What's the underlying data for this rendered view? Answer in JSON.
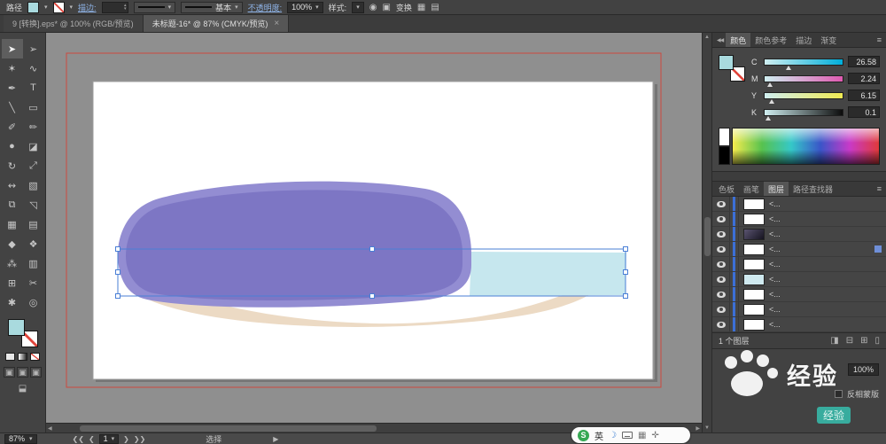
{
  "icons": {
    "caret": "▾",
    "spin_up": "▴",
    "spin_down": "▾",
    "scroll_up": "▲",
    "scroll_down": "▼",
    "scroll_left": "◀",
    "scroll_right": "▶"
  },
  "control_bar": {
    "selection_type": "路径",
    "fill_color": "#a9dade",
    "stroke_label": "描边:",
    "brush_value": "基本",
    "opacity_label": "不透明度:",
    "opacity_value": "100%",
    "style_label": "样式:",
    "recolor_icon": "◉",
    "doc_icon": "▣",
    "transform_label": "变换",
    "align_icon_1": "▦",
    "align_icon_2": "▤"
  },
  "tabs": [
    {
      "label": "9 [转换].eps* @ 100% (RGB/预览)"
    },
    {
      "label": "未标题-16* @ 87% (CMYK/预览)",
      "close": "×"
    }
  ],
  "toolbar": {
    "fill_color": "#a9dade",
    "tools": [
      {
        "name": "selection-tool",
        "glyph": "➤"
      },
      {
        "name": "direct-selection-tool",
        "glyph": "➢"
      },
      {
        "name": "magic-wand-tool",
        "glyph": "✶"
      },
      {
        "name": "lasso-tool",
        "glyph": "∿"
      },
      {
        "name": "pen-tool",
        "glyph": "✒"
      },
      {
        "name": "type-tool",
        "glyph": "T"
      },
      {
        "name": "line-segment-tool",
        "glyph": "╲"
      },
      {
        "name": "rectangle-tool",
        "glyph": "▭"
      },
      {
        "name": "paintbrush-tool",
        "glyph": "✐"
      },
      {
        "name": "pencil-tool",
        "glyph": "✏"
      },
      {
        "name": "blob-brush-tool",
        "glyph": "●"
      },
      {
        "name": "eraser-tool",
        "glyph": "◪"
      },
      {
        "name": "rotate-tool",
        "glyph": "↻"
      },
      {
        "name": "scale-tool",
        "glyph": "⤢"
      },
      {
        "name": "width-tool",
        "glyph": "↭"
      },
      {
        "name": "free-transform-tool",
        "glyph": "▧"
      },
      {
        "name": "shape-builder-tool",
        "glyph": "⧉"
      },
      {
        "name": "perspective-grid-tool",
        "glyph": "◹"
      },
      {
        "name": "mesh-tool",
        "glyph": "▦"
      },
      {
        "name": "gradient-tool",
        "glyph": "▤"
      },
      {
        "name": "eyedropper-tool",
        "glyph": "◆"
      },
      {
        "name": "blend-tool",
        "glyph": "❖"
      },
      {
        "name": "symbol-sprayer-tool",
        "glyph": "⁂"
      },
      {
        "name": "column-graph-tool",
        "glyph": "▥"
      },
      {
        "name": "artboard-tool",
        "glyph": "⊞"
      },
      {
        "name": "slice-tool",
        "glyph": "✂"
      },
      {
        "name": "hand-tool",
        "glyph": "✱"
      },
      {
        "name": "zoom-tool",
        "glyph": "◎"
      }
    ]
  },
  "color_panel": {
    "collapse_icon": "◀◀",
    "menu_icon": "≡",
    "tabs": [
      "颜色",
      "颜色参考",
      "描边",
      "渐变"
    ],
    "sliders": [
      {
        "channel": "C",
        "value": "26.58"
      },
      {
        "channel": "M",
        "value": "2.24"
      },
      {
        "channel": "Y",
        "value": "6.15"
      },
      {
        "channel": "K",
        "value": "0.1"
      }
    ]
  },
  "panel_group2": {
    "tabs": [
      "色板",
      "画笔",
      "图层",
      "路径查找器"
    ],
    "menu_icon": "≡"
  },
  "layers": {
    "rows": [
      {
        "label": "<...",
        "thumb": "white"
      },
      {
        "label": "<...",
        "thumb": "white"
      },
      {
        "label": "<...",
        "thumb": "dark"
      },
      {
        "label": "<...",
        "thumb": "white",
        "selected": "true"
      },
      {
        "label": "<...",
        "thumb": "white"
      },
      {
        "label": "<...",
        "thumb": "blue"
      },
      {
        "label": "<...",
        "thumb": "white"
      },
      {
        "label": "<...",
        "thumb": "white"
      },
      {
        "label": "<...",
        "thumb": "white"
      }
    ],
    "footer_count": "1 个图层",
    "footer_icons": [
      {
        "glyph": "◨"
      },
      {
        "glyph": "⊟"
      },
      {
        "glyph": "⊞"
      },
      {
        "glyph": "▯"
      }
    ]
  },
  "transparency": {
    "opacity_value": "100%",
    "invert_mask_label": "反相蒙版"
  },
  "watermark": {
    "text": "经验",
    "tag": "经验"
  },
  "status_bar": {
    "zoom": "87%",
    "nav_first": "❮❮",
    "nav_prev": "❮",
    "artboard_number": "1",
    "nav_next": "❯",
    "nav_last": "❯❯",
    "tool_name": "选择",
    "menu_arrow": "▶"
  },
  "ime": {
    "logo": "S",
    "mode": "英",
    "moon": "☽",
    "grid": "▦",
    "wrench": "✛"
  },
  "artwork": {
    "artboard_color": "#ffffff",
    "guide_color": "#cc4a3f",
    "shadow_fill": "#ecdac4",
    "stick_fill": "#c6e7ee",
    "body_outline": "#938dd2",
    "body_fill": "#7d76c4",
    "selection_color": "#4a7fd6"
  }
}
